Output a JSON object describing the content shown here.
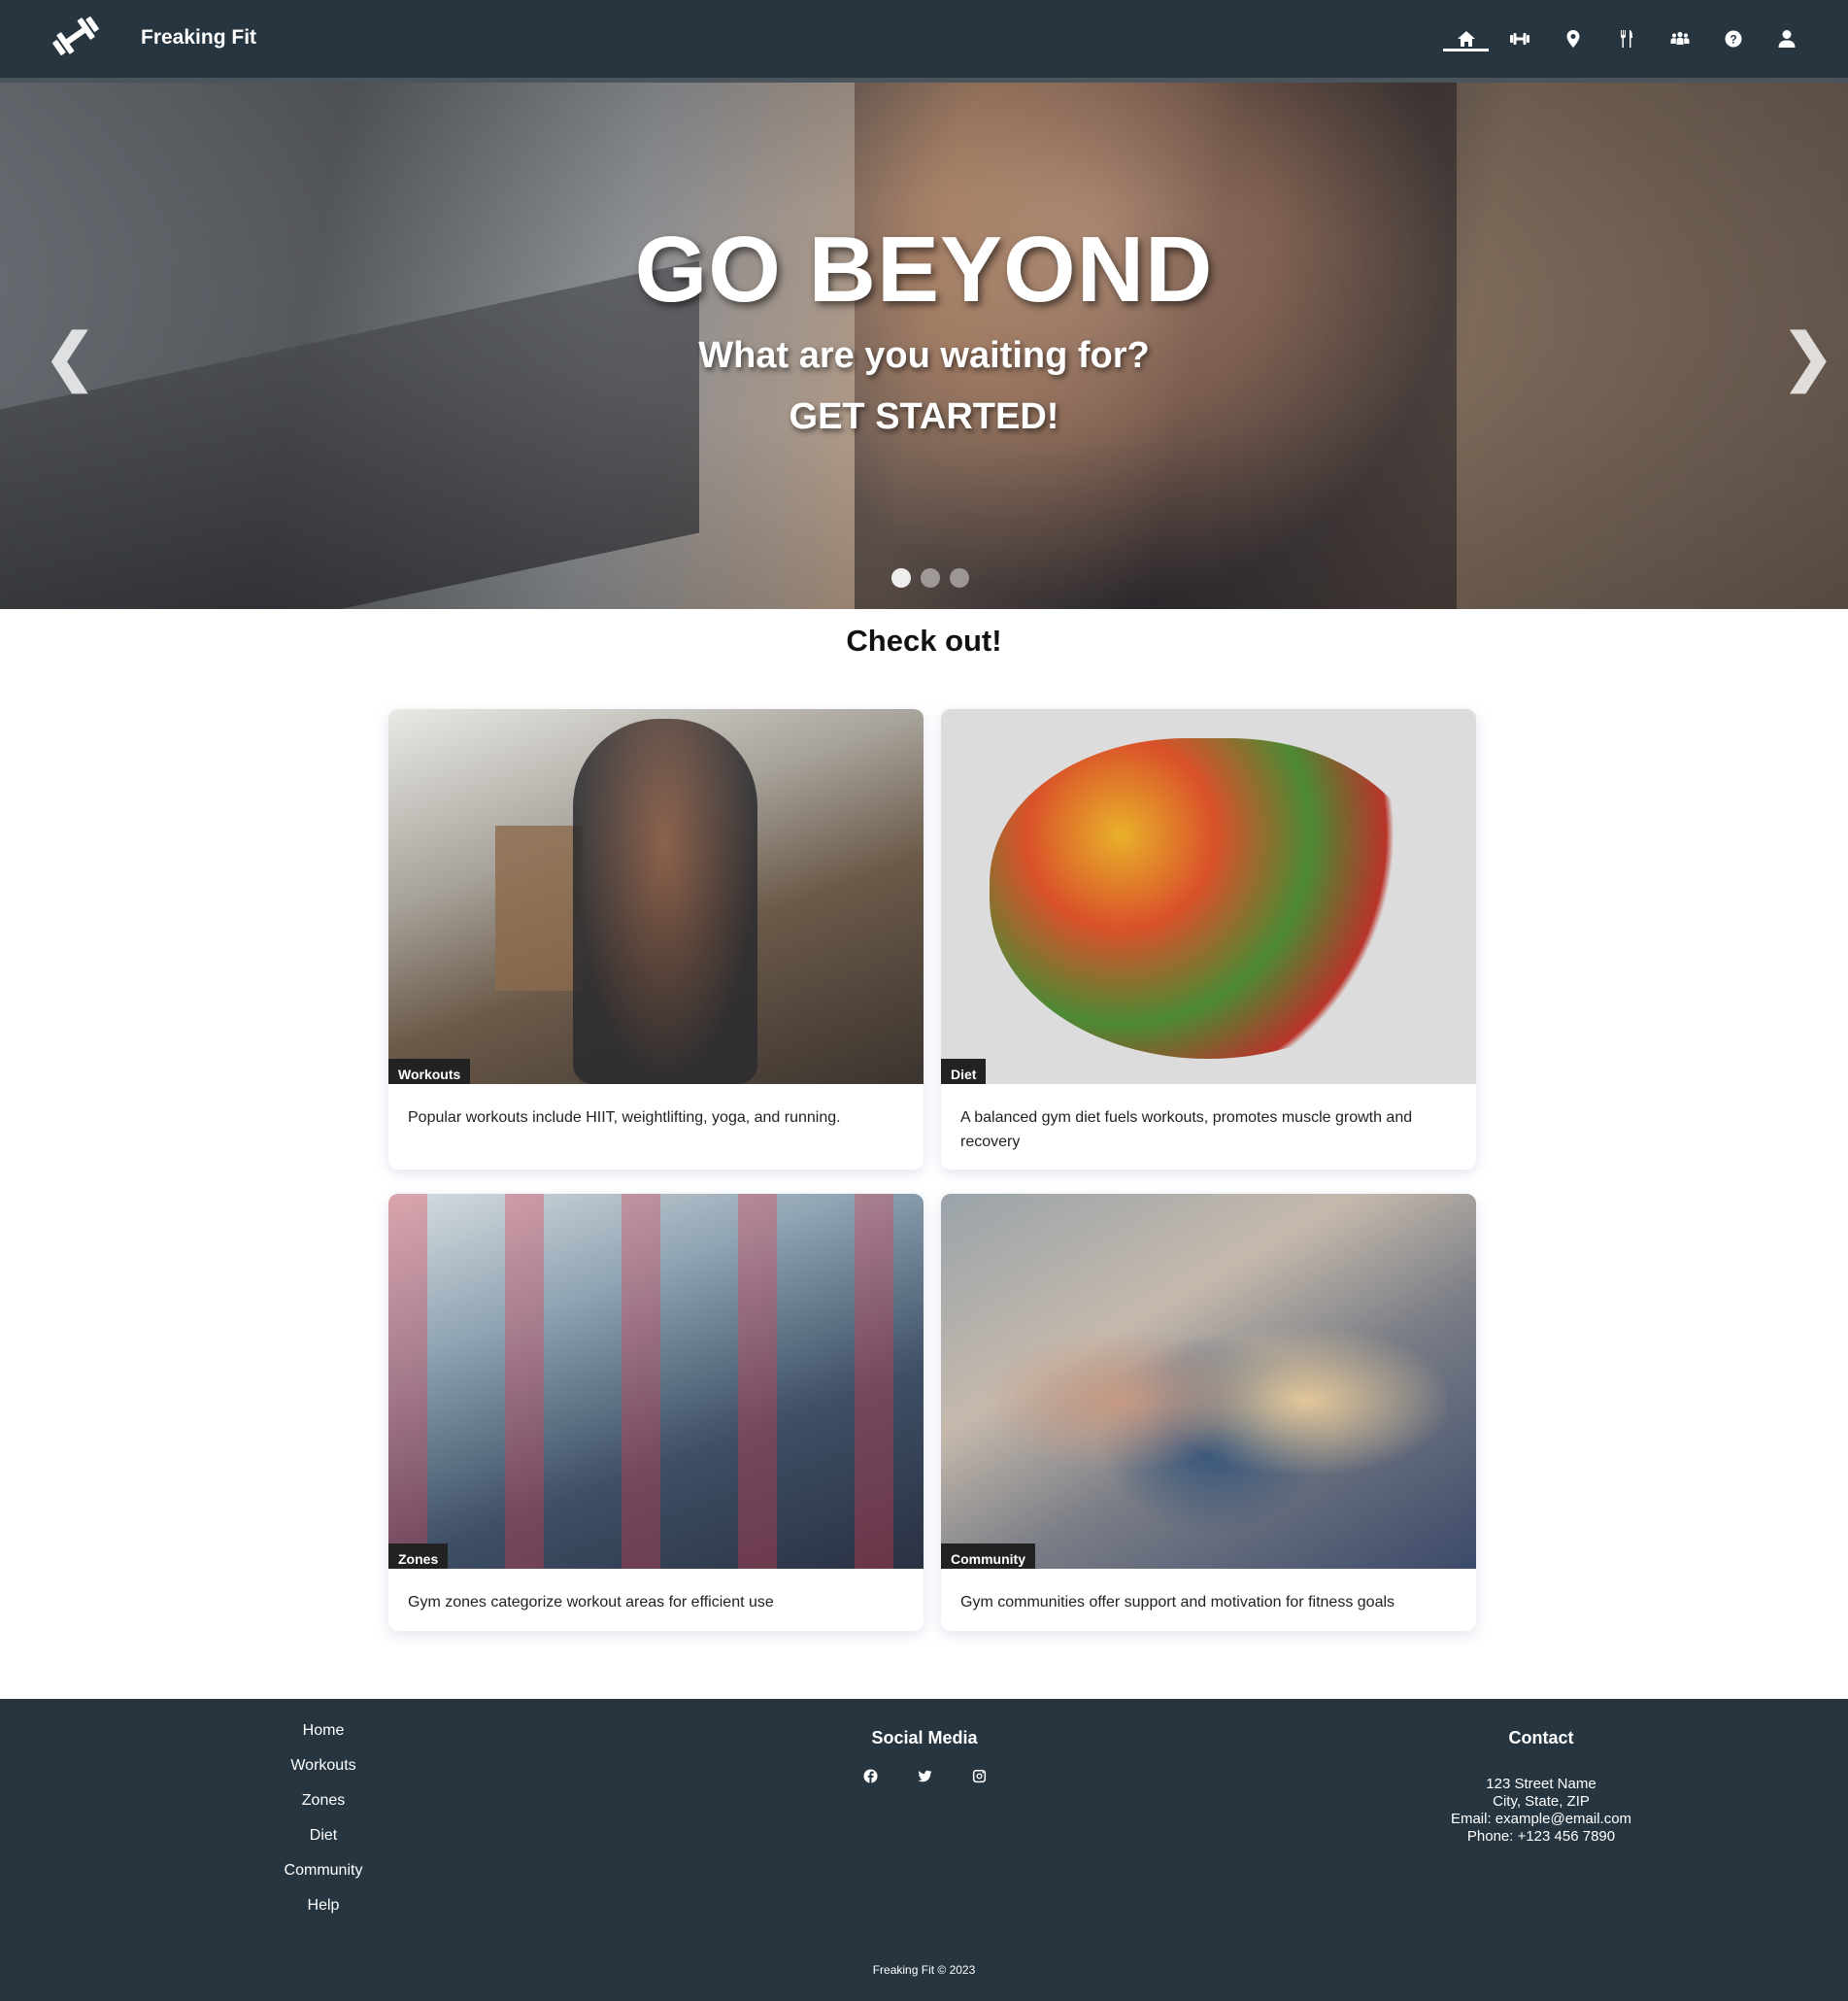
{
  "header": {
    "brand": "Freaking Fit",
    "nav": [
      {
        "icon": "home-icon",
        "active": true
      },
      {
        "icon": "dumbbell-icon",
        "active": false
      },
      {
        "icon": "map-pin-icon",
        "active": false
      },
      {
        "icon": "utensils-icon",
        "active": false
      },
      {
        "icon": "community-icon",
        "active": false
      },
      {
        "icon": "help-icon",
        "active": false
      },
      {
        "icon": "user-icon",
        "active": false
      }
    ]
  },
  "hero": {
    "title": "GO BEYOND",
    "subtitle": "What are you waiting for?",
    "cta": "GET STARTED!",
    "prev": "❮",
    "next": "❯",
    "slides": 3,
    "active_slide": 1
  },
  "section": {
    "title": "Check out!"
  },
  "cards": [
    {
      "tag": "Workouts",
      "desc": "Popular workouts include HIIT, weightlifting, yoga, and running."
    },
    {
      "tag": "Diet",
      "desc": "A balanced gym diet fuels workouts, promotes muscle growth and recovery"
    },
    {
      "tag": "Zones",
      "desc": "Gym zones categorize workout areas for efficient use"
    },
    {
      "tag": "Community",
      "desc": "Gym communities offer support and motivation for fitness goals"
    }
  ],
  "footer": {
    "links": [
      "Home",
      "Workouts",
      "Zones",
      "Diet",
      "Community",
      "Help"
    ],
    "social_heading": "Social Media",
    "social_icons": [
      "facebook-icon",
      "twitter-icon",
      "instagram-icon"
    ],
    "contact_heading": "Contact",
    "contact": {
      "address": "123 Street Name",
      "city": "City, State, ZIP",
      "email": "Email: example@email.com",
      "phone": "Phone: +123 456 7890"
    },
    "copyright": "Freaking Fit © 2023"
  },
  "colors": {
    "header_bg": "#263540",
    "footer_bg": "#263540",
    "tag_bg": "#222222"
  }
}
